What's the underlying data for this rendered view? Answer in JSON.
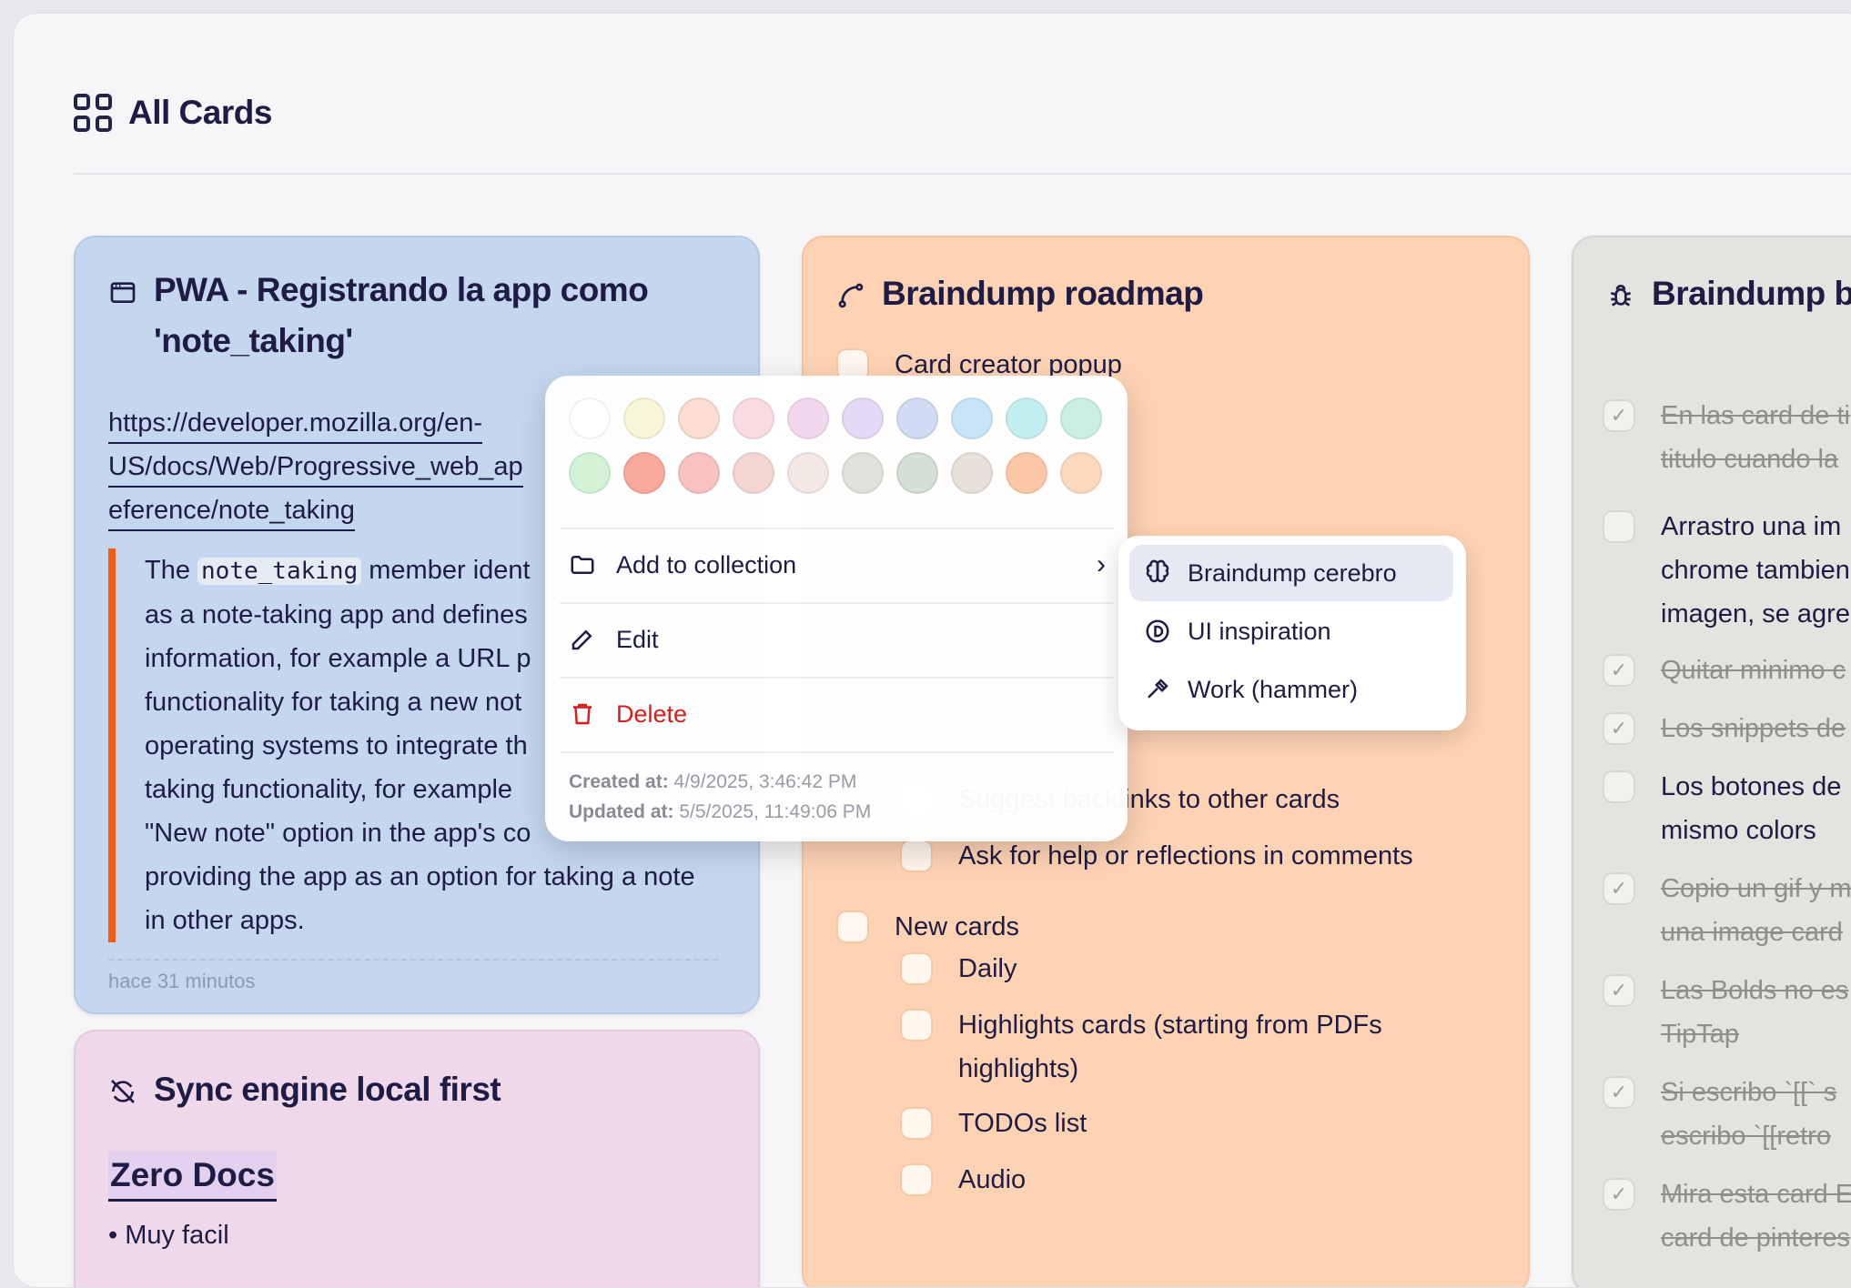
{
  "header": {
    "title": "All Cards",
    "icon": "grid-icon"
  },
  "cards": {
    "pwa": {
      "title_line1": "PWA - Registrando la app como",
      "title_line2": "'note_taking'",
      "icon": "browser-window-icon",
      "link_lines": [
        "https://developer.mozilla.org/en-",
        "US/docs/Web/Progressive_web_ap",
        "eference/note_taking"
      ],
      "quote_code": "note_taking",
      "quote_lines": [
        "The ",
        " member ident",
        "as a note-taking app and defines",
        "information, for example a URL p",
        "functionality for taking a new not",
        "operating systems to integrate th",
        "taking functionality, for example",
        "\"New note\" option in the app's co",
        "providing the app as an option for taking a note",
        "in other apps."
      ],
      "footer": "hace 31 minutos",
      "color": "#c5d7ef"
    },
    "roadmap": {
      "title": "Braindump roadmap",
      "icon": "route-icon",
      "color": "#fed3b4",
      "tasks": {
        "t0": "Card creator popup",
        "t1": "Suggest backlinks to other cards",
        "t2": "Ask for help or reflections in comments",
        "t3": "New cards",
        "t4": "Daily",
        "t5": "Highlights cards (starting from PDFs",
        "t5b": "highlights)",
        "t6": "TODOs list",
        "t7": "Audio"
      }
    },
    "bugs": {
      "title": "Braindump bu",
      "icon": "bug-icon",
      "color": "#e4e3df",
      "items": {
        "b0a": "En las card de ti",
        "b0b": "titulo cuando la",
        "b1a": "Arrastro una im",
        "b1b": "chrome tambien",
        "b1c": "imagen, se agre",
        "b2": "Quitar minimo c",
        "b3": "Los snippets de",
        "b4a": "Los botones de",
        "b4b": "mismo colors",
        "b5a": "Copio un gif y m",
        "b5b": "una image card",
        "b6a": "Las Bolds no es",
        "b6b": "TipTap",
        "b7a": "Si escribo `[[` s",
        "b7b": "escribo `[[retro",
        "b8a": "Mira esta card E",
        "b8b": "card de pinteres"
      }
    },
    "sync": {
      "title": "Sync engine local first",
      "icon": "sync-off-icon",
      "heading": "Zero Docs",
      "bullet": "Muy facil",
      "color": "#efd8ea"
    }
  },
  "context_menu": {
    "swatch_colors": [
      "#ffffff",
      "#f8f6d8",
      "#fcdcd3",
      "#f9dde3",
      "#f2d8ee",
      "#e4d9f5",
      "#d0dcf3",
      "#c8e4f6",
      "#c3eff1",
      "#c9f0e2",
      "#d3f2d6",
      "#f9a89c",
      "#f7c2c1",
      "#f4d6d1",
      "#f3e8e4",
      "#e2e1de",
      "#d6ded8",
      "#e7e1d9",
      "#fdc8a8",
      "#fdd9c0"
    ],
    "add_to_collection": "Add to collection",
    "edit": "Edit",
    "delete": "Delete",
    "created_label": "Created at:",
    "created_value": "4/9/2025, 3:46:42 PM",
    "updated_label": "Updated at:",
    "updated_value": "5/5/2025, 11:49:06 PM"
  },
  "submenu": {
    "items": [
      {
        "label": "Braindump cerebro",
        "icon": "brain-icon"
      },
      {
        "label": "UI inspiration",
        "icon": "d-circle-icon"
      },
      {
        "label": "Work (hammer)",
        "icon": "hammer-icon"
      }
    ]
  },
  "colors": {
    "accent_bar": "#f25c14",
    "delete": "#d91c1c"
  }
}
